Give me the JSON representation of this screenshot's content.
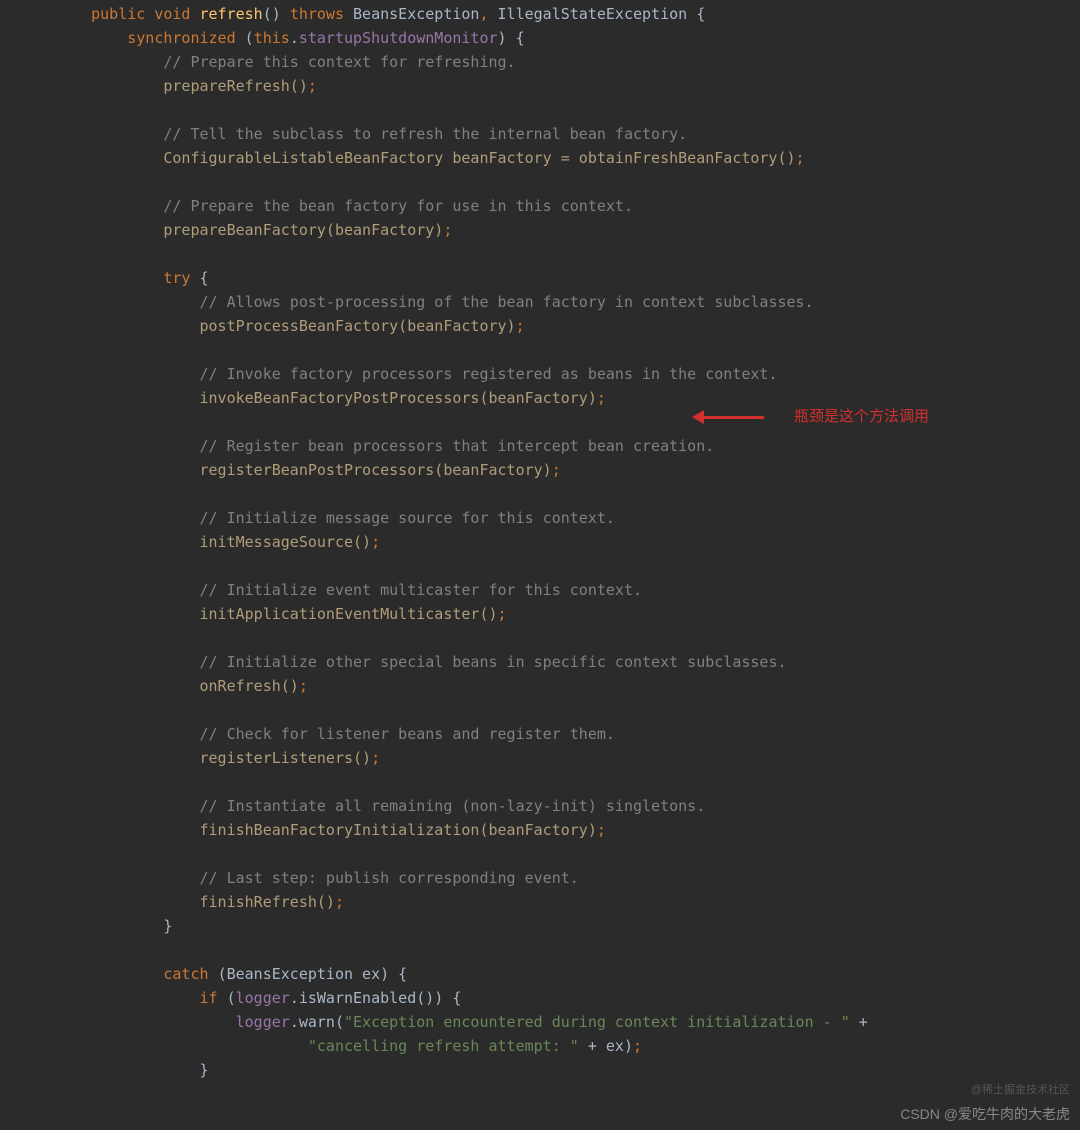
{
  "annotation": {
    "arrow_text": "瓶颈是这个方法调用"
  },
  "watermarks": {
    "top": "@稀土掘金技术社区",
    "bottom": "CSDN @爱吃牛肉的大老虎"
  },
  "code": {
    "lines": [
      {
        "indent": 1,
        "tokens": [
          {
            "t": "public ",
            "c": "kw"
          },
          {
            "t": "void ",
            "c": "kw"
          },
          {
            "t": "refresh",
            "c": "method-def"
          },
          {
            "t": "() ",
            "c": "paren"
          },
          {
            "t": "throws ",
            "c": "kw"
          },
          {
            "t": "BeansException",
            "c": "type"
          },
          {
            "t": ", ",
            "c": "semi"
          },
          {
            "t": "IllegalStateException {",
            "c": "type"
          }
        ]
      },
      {
        "indent": 2,
        "tokens": [
          {
            "t": "synchronized ",
            "c": "kw"
          },
          {
            "t": "(",
            "c": "paren"
          },
          {
            "t": "this",
            "c": "kw"
          },
          {
            "t": ".",
            "c": "paren"
          },
          {
            "t": "startupShutdownMonitor",
            "c": "field"
          },
          {
            "t": ") {",
            "c": "paren"
          }
        ]
      },
      {
        "indent": 3,
        "tokens": [
          {
            "t": "// Prepare this context for refreshing.",
            "c": "comment"
          }
        ]
      },
      {
        "indent": 3,
        "tokens": [
          {
            "t": "prepareRefresh()",
            "c": "method-call"
          },
          {
            "t": ";",
            "c": "semi"
          }
        ]
      },
      {
        "indent": 3,
        "tokens": []
      },
      {
        "indent": 3,
        "tokens": [
          {
            "t": "// Tell the subclass to refresh the internal bean factory.",
            "c": "comment"
          }
        ]
      },
      {
        "indent": 3,
        "tokens": [
          {
            "t": "ConfigurableListableBeanFactory beanFactory = obtainFreshBeanFactory()",
            "c": "method-call"
          },
          {
            "t": ";",
            "c": "semi"
          }
        ]
      },
      {
        "indent": 3,
        "tokens": []
      },
      {
        "indent": 3,
        "tokens": [
          {
            "t": "// Prepare the bean factory for use in this context.",
            "c": "comment"
          }
        ]
      },
      {
        "indent": 3,
        "tokens": [
          {
            "t": "prepareBeanFactory(beanFactory)",
            "c": "method-call"
          },
          {
            "t": ";",
            "c": "semi"
          }
        ]
      },
      {
        "indent": 3,
        "tokens": []
      },
      {
        "indent": 3,
        "tokens": [
          {
            "t": "try ",
            "c": "kw"
          },
          {
            "t": "{",
            "c": "paren"
          }
        ]
      },
      {
        "indent": 4,
        "tokens": [
          {
            "t": "// Allows post-processing of the bean factory in context subclasses.",
            "c": "comment"
          }
        ]
      },
      {
        "indent": 4,
        "tokens": [
          {
            "t": "postProcessBeanFactory(beanFactory)",
            "c": "method-call"
          },
          {
            "t": ";",
            "c": "semi"
          }
        ]
      },
      {
        "indent": 4,
        "tokens": []
      },
      {
        "indent": 4,
        "tokens": [
          {
            "t": "// Invoke factory processors registered as beans in the context.",
            "c": "comment"
          }
        ]
      },
      {
        "indent": 4,
        "tokens": [
          {
            "t": "invokeBeanFactoryPostProcessors(beanFactory)",
            "c": "method-call"
          },
          {
            "t": ";",
            "c": "semi"
          }
        ]
      },
      {
        "indent": 4,
        "tokens": []
      },
      {
        "indent": 4,
        "tokens": [
          {
            "t": "// Register bean processors that intercept bean creation.",
            "c": "comment"
          }
        ]
      },
      {
        "indent": 4,
        "tokens": [
          {
            "t": "registerBeanPostProcessors(beanFactory)",
            "c": "method-call"
          },
          {
            "t": ";",
            "c": "semi"
          }
        ]
      },
      {
        "indent": 4,
        "tokens": []
      },
      {
        "indent": 4,
        "tokens": [
          {
            "t": "// Initialize message source for this context.",
            "c": "comment"
          }
        ]
      },
      {
        "indent": 4,
        "tokens": [
          {
            "t": "initMessageSource()",
            "c": "method-call"
          },
          {
            "t": ";",
            "c": "semi"
          }
        ]
      },
      {
        "indent": 4,
        "tokens": []
      },
      {
        "indent": 4,
        "tokens": [
          {
            "t": "// Initialize event multicaster for this context.",
            "c": "comment"
          }
        ]
      },
      {
        "indent": 4,
        "tokens": [
          {
            "t": "initApplicationEventMulticaster()",
            "c": "method-call"
          },
          {
            "t": ";",
            "c": "semi"
          }
        ]
      },
      {
        "indent": 4,
        "tokens": []
      },
      {
        "indent": 4,
        "tokens": [
          {
            "t": "// Initialize other special beans in specific context subclasses.",
            "c": "comment"
          }
        ]
      },
      {
        "indent": 4,
        "tokens": [
          {
            "t": "onRefresh()",
            "c": "method-call"
          },
          {
            "t": ";",
            "c": "semi"
          }
        ]
      },
      {
        "indent": 4,
        "tokens": []
      },
      {
        "indent": 4,
        "tokens": [
          {
            "t": "// Check for listener beans and register them.",
            "c": "comment"
          }
        ]
      },
      {
        "indent": 4,
        "tokens": [
          {
            "t": "registerListeners()",
            "c": "method-call"
          },
          {
            "t": ";",
            "c": "semi"
          }
        ]
      },
      {
        "indent": 4,
        "tokens": []
      },
      {
        "indent": 4,
        "tokens": [
          {
            "t": "// Instantiate all remaining (non-lazy-init) singletons.",
            "c": "comment"
          }
        ]
      },
      {
        "indent": 4,
        "tokens": [
          {
            "t": "finishBeanFactoryInitialization(beanFactory)",
            "c": "method-call"
          },
          {
            "t": ";",
            "c": "semi"
          }
        ]
      },
      {
        "indent": 4,
        "tokens": []
      },
      {
        "indent": 4,
        "tokens": [
          {
            "t": "// Last step: publish corresponding event.",
            "c": "comment"
          }
        ]
      },
      {
        "indent": 4,
        "tokens": [
          {
            "t": "finishRefresh()",
            "c": "method-call"
          },
          {
            "t": ";",
            "c": "semi"
          }
        ]
      },
      {
        "indent": 3,
        "tokens": [
          {
            "t": "}",
            "c": "paren"
          }
        ]
      },
      {
        "indent": 3,
        "tokens": []
      },
      {
        "indent": 3,
        "tokens": [
          {
            "t": "catch ",
            "c": "kw"
          },
          {
            "t": "(BeansException ex) {",
            "c": "paren"
          }
        ]
      },
      {
        "indent": 4,
        "tokens": [
          {
            "t": "if ",
            "c": "kw"
          },
          {
            "t": "(",
            "c": "paren"
          },
          {
            "t": "logger",
            "c": "field"
          },
          {
            "t": ".isWarnEnabled()) {",
            "c": "paren"
          }
        ]
      },
      {
        "indent": 5,
        "tokens": [
          {
            "t": "logger",
            "c": "field"
          },
          {
            "t": ".warn(",
            "c": "paren"
          },
          {
            "t": "\"Exception encountered during context initialization - \"",
            "c": "str"
          },
          {
            "t": " +",
            "c": "paren"
          }
        ]
      },
      {
        "indent": 7,
        "tokens": [
          {
            "t": "\"cancelling refresh attempt: \"",
            "c": "str"
          },
          {
            "t": " + ex)",
            "c": "paren"
          },
          {
            "t": ";",
            "c": "semi"
          }
        ]
      },
      {
        "indent": 4,
        "tokens": [
          {
            "t": "}",
            "c": "paren"
          }
        ]
      }
    ]
  }
}
